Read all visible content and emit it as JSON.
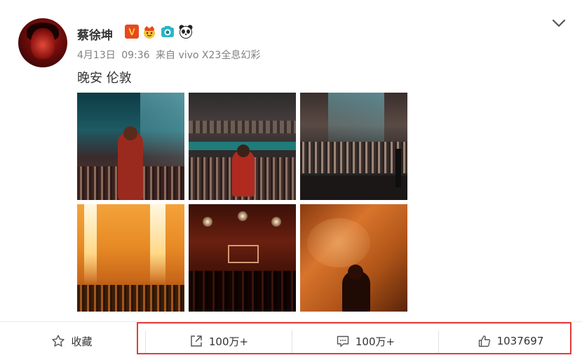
{
  "post": {
    "username": "蔡徐坤",
    "verified_badge": "V",
    "badges": [
      "crown-emoji-icon",
      "camera-emoji-icon",
      "panda-emoji-icon"
    ],
    "meta": {
      "date": "4月13日",
      "time": "09:36",
      "source": "来自 vivo X23全息幻彩"
    },
    "text": "晚安 伦敦",
    "images": [
      "stage-back-view-photo",
      "stage-seated-photo",
      "crowd-wide-photo",
      "pyrotechnics-photo",
      "kun-sign-crowd-photo",
      "closeup-orange-photo"
    ]
  },
  "actions": {
    "favorite_label": "收藏",
    "repost_count": "100万+",
    "comment_count": "100万+",
    "like_count": "1037697"
  },
  "colors": {
    "highlight_border": "#e63a3a",
    "verified_bg": "#e8491d",
    "meta_text": "#808080"
  }
}
